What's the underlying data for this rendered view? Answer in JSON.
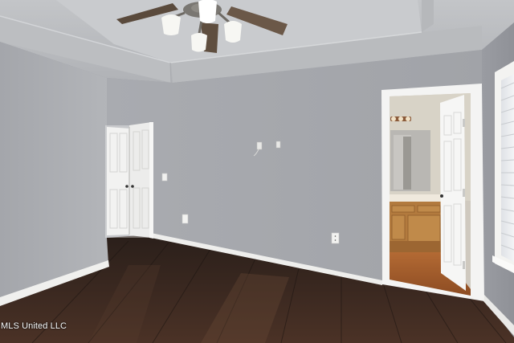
{
  "photo": {
    "watermark_text": "MLS United LLC",
    "colors": {
      "wall": "#a6a8ad",
      "ceiling": "#b4b6ba",
      "floor_dark": "#2a1d17",
      "floor_light": "#4a3428",
      "trim": "#f2f2f0",
      "bath_floor": "#a35a2a",
      "cabinet": "#b27a3e"
    },
    "icons": {
      "ceiling_fan": "ceiling-fan-icon",
      "outlet": "outlet-icon",
      "light_switch": "light-switch-icon"
    }
  }
}
